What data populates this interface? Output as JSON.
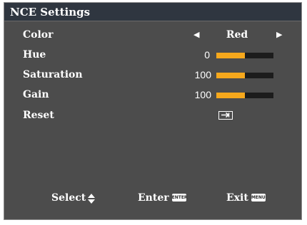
{
  "title": "NCE Settings",
  "rows": {
    "color": {
      "label": "Color",
      "value": "Red"
    },
    "hue": {
      "label": "Hue",
      "value": "0",
      "level": 0.5
    },
    "saturation": {
      "label": "Saturation",
      "value": "100",
      "level": 0.5
    },
    "gain": {
      "label": "Gain",
      "value": "100",
      "level": 0.5
    },
    "reset": {
      "label": "Reset"
    }
  },
  "footer": {
    "select": "Select",
    "enter": "Enter",
    "enter_key": "ENTER",
    "exit": "Exit",
    "exit_key": "MENU"
  },
  "colors": {
    "bar_fill": "#f6a81c",
    "bar_track": "#1c1c1c",
    "panel_bg": "#4c4c4c",
    "title_bg": "#2f3640"
  },
  "icons": {
    "left": "triangle-left-icon",
    "right": "triangle-right-icon",
    "reset": "enter-arrow-icon",
    "updown": "up-down-arrows-icon",
    "enter_key": "enter-key-icon",
    "menu_key": "menu-key-icon"
  }
}
